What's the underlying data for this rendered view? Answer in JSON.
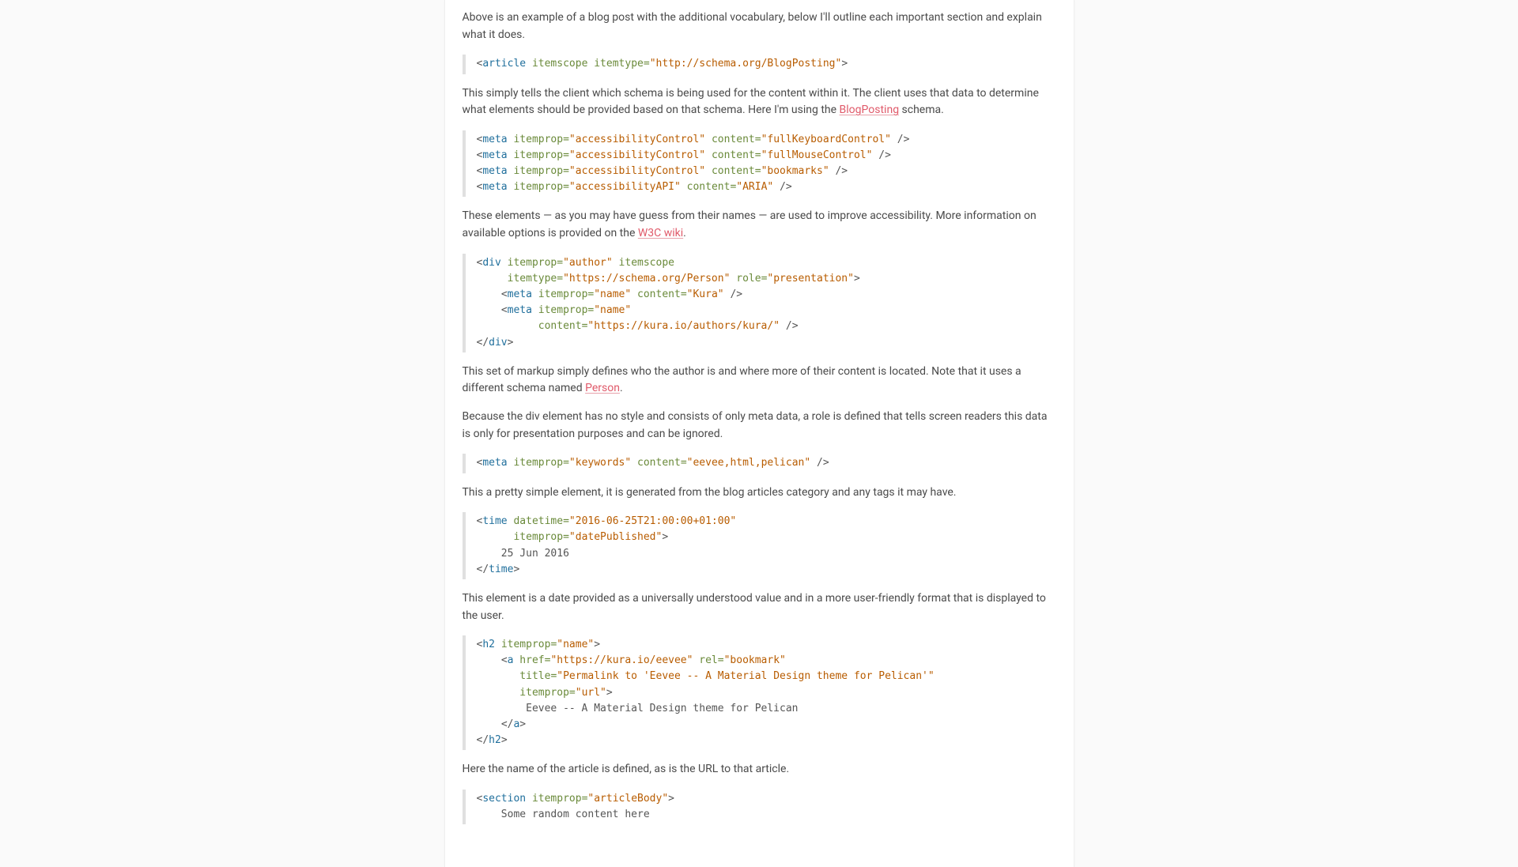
{
  "paragraphs": {
    "intro": "Above is an example of a blog post with the additional vocabulary, below I'll outline each important section and explain what it does.",
    "p1_pre": "This simply tells the client which schema is being used for the content within it. The client uses that data to determine what elements should be provided based on that schema. Here I'm using the ",
    "p1_link": "BlogPosting",
    "p1_post": " schema.",
    "p2_pre": "These elements — as you may have guess from their names — are used to improve accessibility. More information on available options is provided on the ",
    "p2_link": "W3C wiki",
    "p2_post": ".",
    "p3_pre": "This set of markup simply defines who the author is and where more of their content is located. Note that it uses a different schema named ",
    "p3_link": "Person",
    "p3_post": ".",
    "p4": "Because the div element has no style and consists of only meta data, a role is defined that tells screen readers this data is only for presentation purposes and can be ignored.",
    "p5": "This a pretty simple element, it is generated from the blog articles category and any tags it may have.",
    "p6": "This element is a date provided as a universally understood value and in a more user-friendly format that is displayed to the user.",
    "p7": "Here the name of the article is defined, as is the URL to that article."
  },
  "code": {
    "c1": {
      "tag": "article",
      "a1": "itemscope",
      "a2": "itemtype",
      "v2": "\"http://schema.org/BlogPosting\""
    },
    "c2": {
      "l1": {
        "tag": "meta",
        "a1": "itemprop",
        "v1": "\"accessibilityControl\"",
        "a2": "content",
        "v2": "\"fullKeyboardControl\""
      },
      "l2": {
        "tag": "meta",
        "a1": "itemprop",
        "v1": "\"accessibilityControl\"",
        "a2": "content",
        "v2": "\"fullMouseControl\""
      },
      "l3": {
        "tag": "meta",
        "a1": "itemprop",
        "v1": "\"accessibilityControl\"",
        "a2": "content",
        "v2": "\"bookmarks\""
      },
      "l4": {
        "tag": "meta",
        "a1": "itemprop",
        "v1": "\"accessibilityAPI\"",
        "a2": "content",
        "v2": "\"ARIA\""
      }
    },
    "c3": {
      "open_tag": "div",
      "open_a1": "itemprop",
      "open_v1": "\"author\"",
      "open_a2": "itemscope",
      "open_a3": "itemtype",
      "open_v3": "\"https://schema.org/Person\"",
      "open_a4": "role",
      "open_v4": "\"presentation\"",
      "m1": {
        "tag": "meta",
        "a1": "itemprop",
        "v1": "\"name\"",
        "a2": "content",
        "v2": "\"Kura\""
      },
      "m2": {
        "tag": "meta",
        "a1": "itemprop",
        "v1": "\"name\"",
        "a2": "content",
        "v2": "\"https://kura.io/authors/kura/\""
      },
      "close_tag": "div"
    },
    "c4": {
      "tag": "meta",
      "a1": "itemprop",
      "v1": "\"keywords\"",
      "a2": "content",
      "v2": "\"eevee,html,pelican\""
    },
    "c5": {
      "tag": "time",
      "a1": "datetime",
      "v1": "\"2016-06-25T21:00:00+01:00\"",
      "a2": "itemprop",
      "v2": "\"datePublished\"",
      "text": "    25 Jun 2016",
      "close_tag": "time"
    },
    "c6": {
      "h2_tag": "h2",
      "h2_a1": "itemprop",
      "h2_v1": "\"name\"",
      "a_tag": "a",
      "a_a1": "href",
      "a_v1": "\"https://kura.io/eevee\"",
      "a_a2": "rel",
      "a_v2": "\"bookmark\"",
      "a_a3": "title",
      "a_v3": "\"Permalink to 'Eevee -- A Material Design theme for Pelican'\"",
      "a_a4": "itemprop",
      "a_v4": "\"url\"",
      "link_text": "        Eevee -- A Material Design theme for Pelican"
    },
    "c7": {
      "tag": "section",
      "a1": "itemprop",
      "v1": "\"articleBody\"",
      "text": "    Some random content here"
    }
  }
}
